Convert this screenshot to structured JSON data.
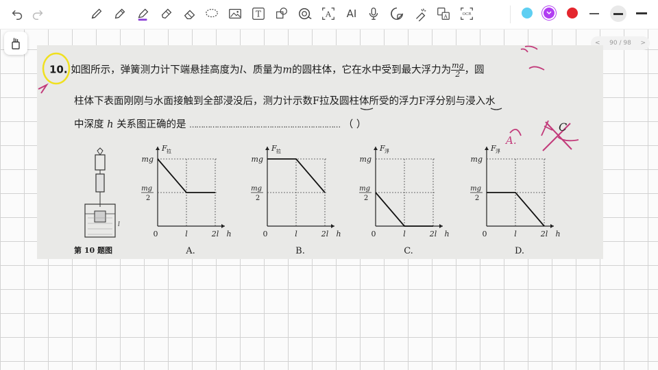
{
  "toolbar": {
    "tools": [
      "undo-icon",
      "redo-icon",
      "pen-icon",
      "pencil-icon",
      "highlighter-icon",
      "marker-icon",
      "eraser-icon",
      "lasso-icon",
      "image-icon",
      "text-icon",
      "shape-icon",
      "tape-icon",
      "text-recognize-icon",
      "ai-icon",
      "microphone-icon",
      "sticker-icon",
      "laser-icon",
      "translate-icon",
      "ocr-icon"
    ],
    "ai_label": "AI",
    "ocr_label": "OCR",
    "text_label": "T",
    "colors": [
      "#5ecff2",
      "#b13df2",
      "#e4262e"
    ]
  },
  "pager": {
    "prev": "<",
    "label": "90 / 98",
    "next": ">"
  },
  "question": {
    "number": "10.",
    "line1_a": "如图所示，弹簧测力计下端悬挂高度为",
    "l": "l",
    "line1_b": "、质量为",
    "m": "m",
    "line1_c": "的圆柱体，它在水中受到最大浮力为",
    "frac_num": "mg",
    "frac_den": "2",
    "line1_d": "，圆",
    "line2": "柱体下表面刚刚与水面接触到全部浸没后，测力计示数F拉及圆柱体所受的浮力F浮分别与浸入水",
    "line3_a": "中深度",
    "h": "h",
    "line3_b": "关系图正确的是",
    "dots": "…………………………………………………………",
    "paren_open": "（",
    "paren_close": "）",
    "handwritten_answer": "C",
    "handwritten_wrong": "A."
  },
  "figure": {
    "caption": "第 10 题图",
    "label_l": "l"
  },
  "graphs": [
    {
      "option": "A.",
      "ylabel": "F",
      "ysub": "拉",
      "shape": "flat-down-flat-high",
      "y_top": "mg",
      "y_mid_num": "mg",
      "y_mid_den": "2",
      "x0": "0",
      "x1": "l",
      "x2": "2l",
      "xh": "h"
    },
    {
      "option": "B.",
      "ylabel": "F",
      "ysub": "拉",
      "y_top": "mg",
      "y_mid_num": "mg",
      "y_mid_den": "2",
      "x0": "0",
      "x1": "l",
      "x2": "2l",
      "xh": "h"
    },
    {
      "option": "C.",
      "ylabel": "F",
      "ysub": "浮",
      "y_top": "mg",
      "y_mid_num": "mg",
      "y_mid_den": "2",
      "x0": "0",
      "x1": "l",
      "x2": "2l",
      "xh": "h"
    },
    {
      "option": "D.",
      "ylabel": "F",
      "ysub": "浮",
      "y_top": "mg",
      "y_mid_num": "mg",
      "y_mid_den": "2",
      "x0": "0",
      "x1": "l",
      "x2": "2l",
      "xh": "h"
    }
  ],
  "chart_data": [
    {
      "type": "line",
      "title": "A",
      "x": [
        0,
        1,
        2
      ],
      "y": [
        1,
        0.5,
        0.5
      ],
      "x_ticks": [
        "0",
        "l",
        "2l"
      ],
      "y_ticks": [
        "mg/2",
        "mg"
      ],
      "note": "F拉 vs h"
    },
    {
      "type": "line",
      "title": "B",
      "x": [
        0,
        1,
        2
      ],
      "y": [
        1,
        1,
        0.5
      ],
      "x_ticks": [
        "0",
        "l",
        "2l"
      ],
      "y_ticks": [
        "mg/2",
        "mg"
      ],
      "note": "F拉 vs h"
    },
    {
      "type": "line",
      "title": "C",
      "x": [
        0,
        1,
        2
      ],
      "y": [
        0.5,
        0,
        0
      ],
      "x_ticks": [
        "0",
        "l",
        "2l"
      ],
      "y_ticks": [
        "mg/2",
        "mg"
      ],
      "note": "F浮 vs h"
    },
    {
      "type": "line",
      "title": "D",
      "x": [
        0,
        1,
        2
      ],
      "y": [
        0.5,
        0.5,
        0
      ],
      "x_ticks": [
        "0",
        "l",
        "2l"
      ],
      "y_ticks": [
        "mg/2",
        "mg"
      ],
      "note": "F浮 vs h"
    }
  ]
}
